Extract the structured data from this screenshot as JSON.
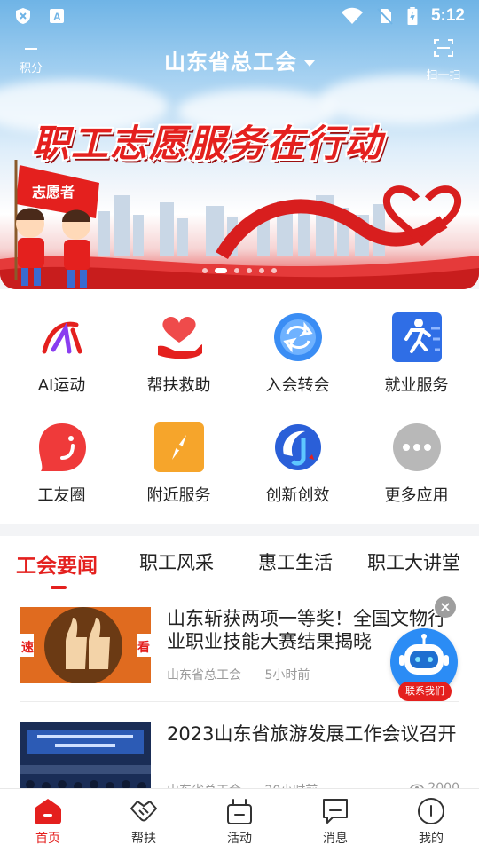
{
  "status_bar": {
    "time": "5:12",
    "icons": [
      "shield-x-icon",
      "keyboard-a-icon",
      "wifi-icon",
      "no-sim-icon",
      "battery-charging-icon"
    ]
  },
  "header": {
    "left_label": "积分",
    "title": "山东省总工会",
    "right_label": "扫一扫"
  },
  "banner": {
    "slogan": "职工志愿服务在行动",
    "flag_text": "志愿者",
    "slide_count": 6,
    "active_slide": 1
  },
  "quick_grid": {
    "items": [
      {
        "label": "AI运动",
        "icon": "ai-sport-icon"
      },
      {
        "label": "帮扶救助",
        "icon": "heart-hand-icon"
      },
      {
        "label": "入会转会",
        "icon": "transfer-icon"
      },
      {
        "label": "就业服务",
        "icon": "running-man-icon"
      },
      {
        "label": "工友圈",
        "icon": "smile-bubble-icon"
      },
      {
        "label": "附近服务",
        "icon": "compass-icon"
      },
      {
        "label": "创新创效",
        "icon": "innovation-icon"
      },
      {
        "label": "更多应用",
        "icon": "more-dots-icon"
      }
    ]
  },
  "news": {
    "tabs": [
      "工会要闻",
      "职工风采",
      "惠工生活",
      "职工大讲堂"
    ],
    "active_tab": 0,
    "articles": [
      {
        "title": "山东斩获两项一等奖！全国文物行业职业技能大赛结果揭晓",
        "source": "山东省总工会",
        "time": "5小时前",
        "views": "",
        "thumb_text_left": "速",
        "thumb_text_right": "看"
      },
      {
        "title": "2023山东省旅游发展工作会议召开",
        "source": "山东省总工会",
        "time": "20小时前",
        "views": "2000",
        "thumb_text_left": "",
        "thumb_text_right": ""
      }
    ]
  },
  "contact": {
    "label": "联系我们",
    "close": "×"
  },
  "bottom_nav": {
    "items": [
      {
        "label": "首页",
        "icon": "home-icon"
      },
      {
        "label": "帮扶",
        "icon": "handshake-icon"
      },
      {
        "label": "活动",
        "icon": "gift-box-icon"
      },
      {
        "label": "消息",
        "icon": "message-icon"
      },
      {
        "label": "我的",
        "icon": "profile-icon"
      }
    ],
    "active": 0
  },
  "colors": {
    "accent": "#e4201e",
    "sky": "#6fb4e6",
    "text": "#222222",
    "muted": "#9a9a9a",
    "bot_blue": "#2b8cf5"
  }
}
